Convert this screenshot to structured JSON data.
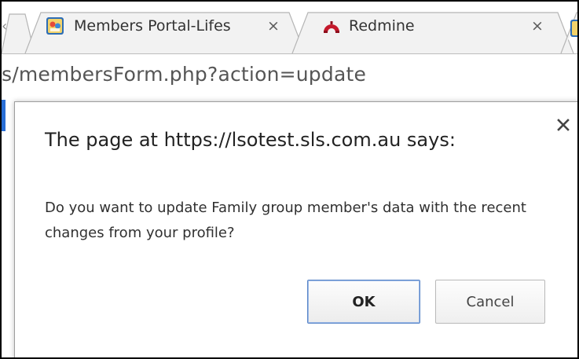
{
  "browser": {
    "tabs": [
      {
        "title": "Members Portal-Lifes",
        "favicon": "members-portal-favicon-icon",
        "close_glyph": "×",
        "active": false
      },
      {
        "title": "Redmine",
        "favicon": "redmine-favicon-icon",
        "close_glyph": "×",
        "active": false
      }
    ],
    "address_bar": {
      "url_visible": "s/membersForm.php?action=update"
    }
  },
  "dialog": {
    "title": "The page at https://lsotest.sls.com.au says:",
    "message": "Do you want to update Family group member's data with the recent changes from your profile?",
    "close_icon": "close-icon",
    "ok_label": "OK",
    "cancel_label": "Cancel"
  },
  "colors": {
    "ok_border": "#5a86c8",
    "tab_border": "#b5b5b5",
    "redmine_red": "#c4182b",
    "favicon_blue": "#2d6db5"
  }
}
